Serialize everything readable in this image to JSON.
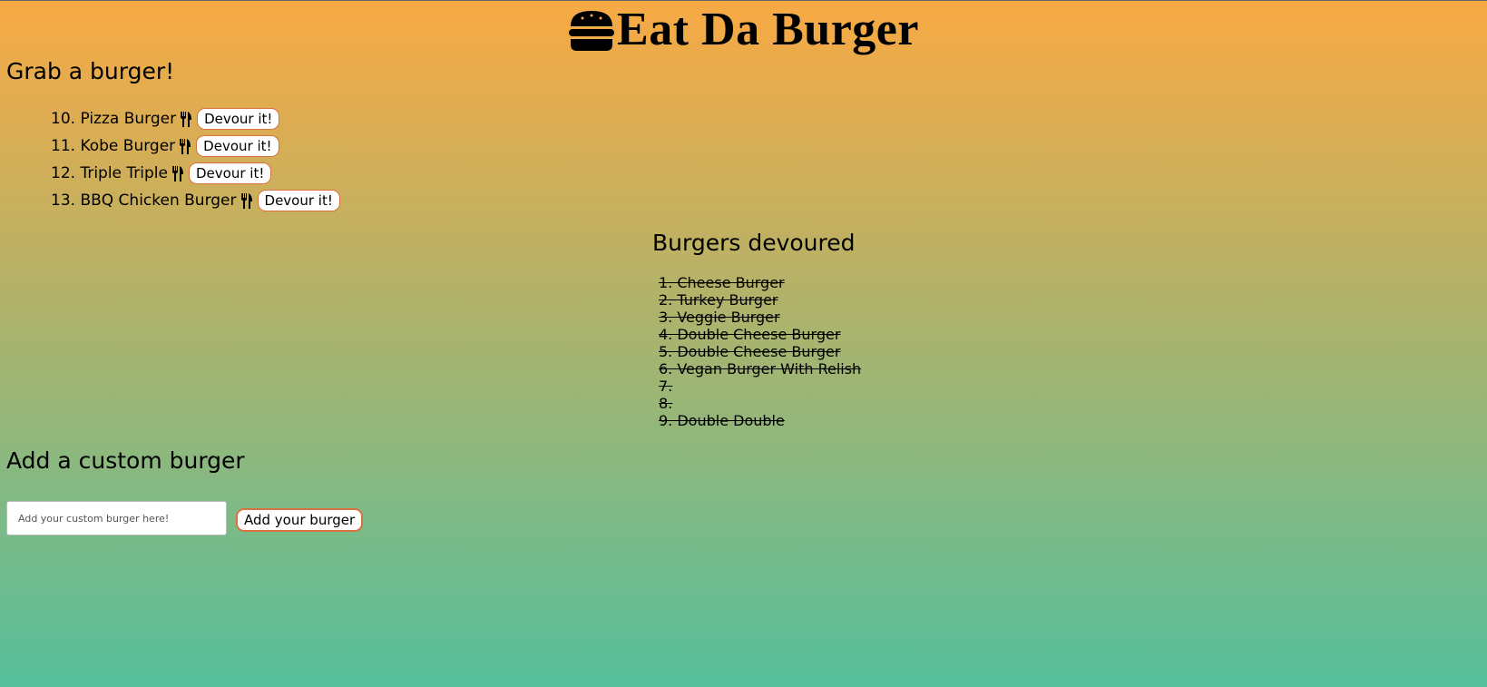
{
  "header": {
    "title": "Eat Da Burger",
    "icon": "hamburger-icon"
  },
  "available": {
    "heading": "Grab a burger!",
    "items": [
      {
        "label": "10. Pizza Burger",
        "button": "Devour it!"
      },
      {
        "label": "11. Kobe Burger",
        "button": "Devour it!"
      },
      {
        "label": "12. Triple Triple",
        "button": "Devour it!"
      },
      {
        "label": "13. BBQ Chicken Burger",
        "button": "Devour it!"
      }
    ],
    "item_icon": "fork-knife-icon"
  },
  "devoured": {
    "heading": "Burgers devoured",
    "items": [
      "1. Cheese Burger",
      "2. Turkey Burger",
      "3. Veggie Burger",
      "4. Double Cheese Burger",
      "5. Double Cheese Burger",
      "6. Vegan Burger With Relish",
      "7.",
      "8.",
      "9. Double Double"
    ]
  },
  "custom": {
    "heading": "Add a custom burger",
    "placeholder": "Add your custom burger here!",
    "value": "",
    "button": "Add your burger"
  },
  "colors": {
    "gradient_top": "#F9A943",
    "gradient_bottom": "#55BF9C",
    "button_border": "#D8733F"
  }
}
